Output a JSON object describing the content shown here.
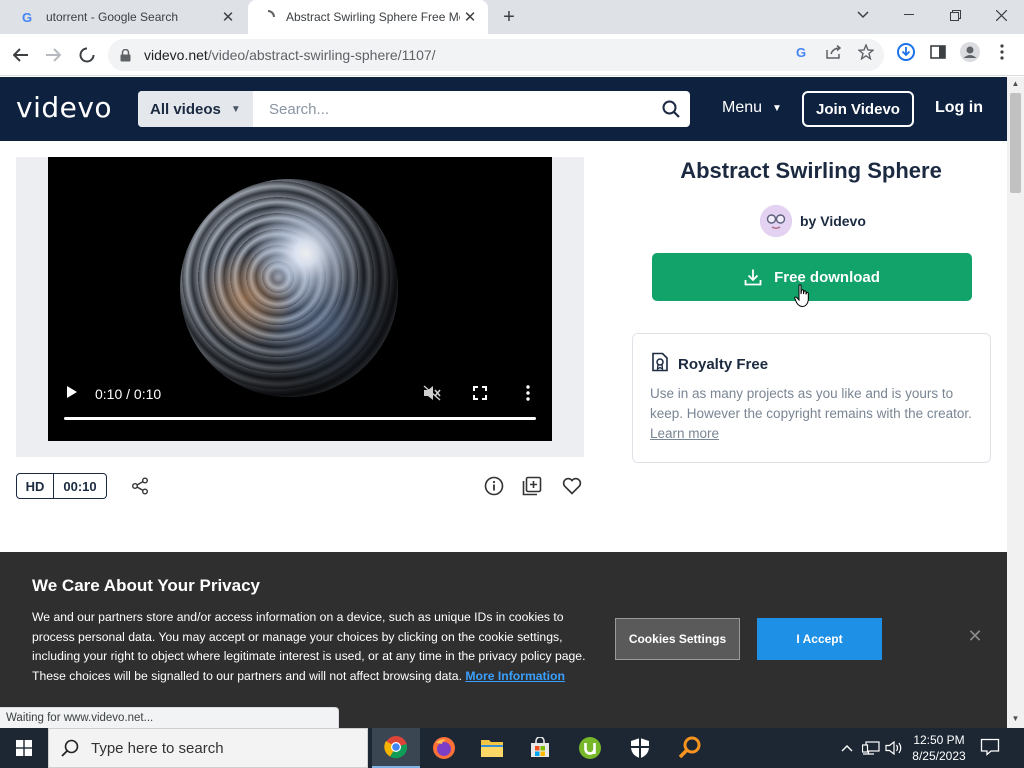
{
  "browser": {
    "tabs": [
      {
        "title": "utorrent - Google Search",
        "favicon": "google-g-icon",
        "active": false
      },
      {
        "title": "Abstract Swirling Sphere Free Mo",
        "favicon": "loading-spinner-icon",
        "active": true
      }
    ],
    "url_host": "videvo.net",
    "url_path": "/video/abstract-swirling-sphere/1107/",
    "status_text": "Waiting for www.videvo.net..."
  },
  "site": {
    "logo": "videvo",
    "search": {
      "category": "All videos",
      "placeholder": "Search..."
    },
    "nav": {
      "menu": "Menu",
      "join": "Join Videvo",
      "login": "Log in"
    },
    "colors": {
      "header_bg": "#0e2240",
      "download_green": "#11a36a",
      "accept_blue": "#1e90e6"
    }
  },
  "video": {
    "time": "0:10 / 0:10",
    "quality_badge": "HD",
    "duration_badge": "00:10",
    "progress": 1.0
  },
  "details": {
    "title": "Abstract Swirling Sphere",
    "author_prefix": "by",
    "author": "Videvo",
    "download_label": "Free download",
    "license_title": "Royalty Free",
    "license_text": "Use in as many projects as you like and is yours to keep. However the copyright remains with the creator.",
    "license_link": "Learn more"
  },
  "cookie_banner": {
    "title": "We Care About Your Privacy",
    "text": "We and our partners store and/or access information on a device, such as unique IDs in cookies to process personal data. You may accept or manage your choices by clicking on the cookie settings, including your right to object where legitimate interest is used, or at any time in the privacy policy page. These choices will be signalled to our partners and will not affect browsing data.",
    "more_link": "More Information",
    "settings_button": "Cookies Settings",
    "accept_button": "I Accept"
  },
  "taskbar": {
    "search_placeholder": "Type here to search",
    "time": "12:50 PM",
    "date": "8/25/2023"
  }
}
